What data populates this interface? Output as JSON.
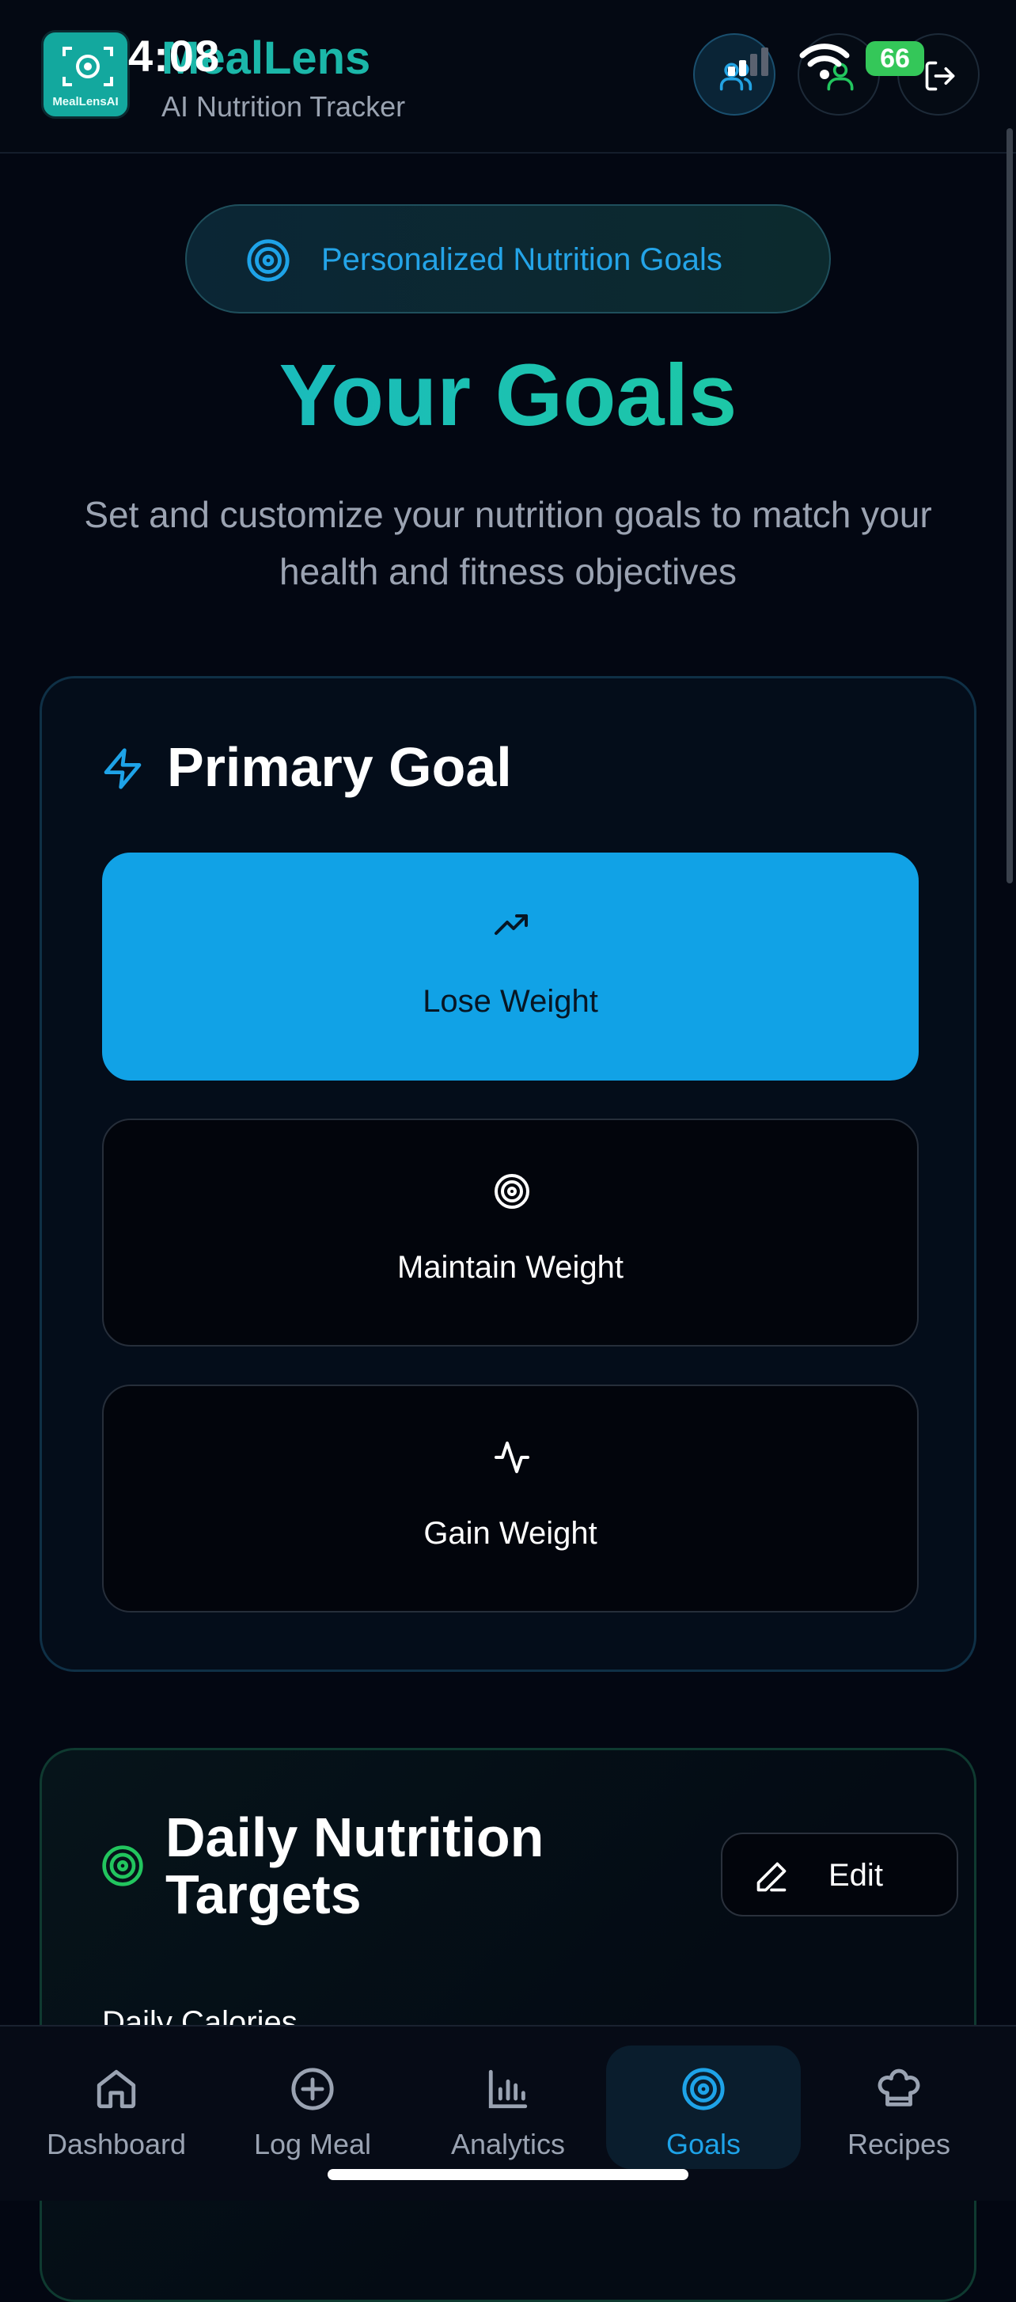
{
  "status_bar": {
    "time": "4:08",
    "battery": "66"
  },
  "header": {
    "logo_text": "MealLensAI",
    "title": "MealLens",
    "subtitle": "AI Nutrition Tracker",
    "buttons": [
      {
        "icon": "users-icon"
      },
      {
        "icon": "user-icon"
      },
      {
        "icon": "logout-icon"
      }
    ]
  },
  "hero": {
    "badge": "Personalized Nutrition Goals",
    "title": "Your Goals",
    "description": "Set and customize your nutrition goals to match your health and fitness objectives"
  },
  "primary_goal": {
    "title": "Primary Goal",
    "options": [
      {
        "label": "Lose Weight",
        "icon": "trending-up-icon",
        "selected": true
      },
      {
        "label": "Maintain Weight",
        "icon": "target-icon",
        "selected": false
      },
      {
        "label": "Gain Weight",
        "icon": "activity-icon",
        "selected": false
      }
    ]
  },
  "daily_targets": {
    "title_line1": "Daily Nutrition",
    "title_line2": "Targets",
    "edit_label": "Edit",
    "first_field": "Daily Calories"
  },
  "bottom_nav": {
    "items": [
      {
        "label": "Dashboard",
        "icon": "home-icon",
        "active": false
      },
      {
        "label": "Log Meal",
        "icon": "plus-circle-icon",
        "active": false
      },
      {
        "label": "Analytics",
        "icon": "bar-chart-icon",
        "active": false
      },
      {
        "label": "Goals",
        "icon": "target-icon",
        "active": true
      },
      {
        "label": "Recipes",
        "icon": "chef-hat-icon",
        "active": false
      }
    ]
  },
  "colors": {
    "accent_blue": "#11a2e6",
    "accent_teal": "#1bb7a9",
    "accent_green": "#22c55e",
    "background": "#030712"
  }
}
